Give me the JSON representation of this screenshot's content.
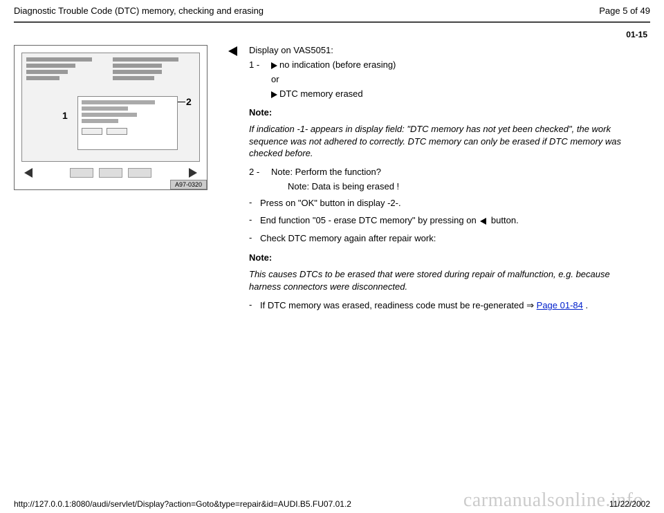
{
  "header": {
    "title": "Diagnostic Trouble Code (DTC) memory, checking and erasing",
    "page_label": "Page 5 of 49"
  },
  "section_number": "01-15",
  "figure": {
    "label_1": "1",
    "label_2": "2",
    "tag": "A97-0320"
  },
  "body": {
    "display_heading": "Display on VAS5051:",
    "item1_num": "1 - ",
    "item1_text": "no indication (before erasing)",
    "item1_or": "or",
    "item1_alt": "DTC memory erased",
    "note1_label": "Note:",
    "note1_text": "If indication -1- appears in display field: \"DTC memory has not yet been checked\", the work sequence was not adhered to correctly. DTC memory can only be erased if DTC memory was checked before.",
    "item2_num": "2 - ",
    "item2_text": "Note: Perform the function?",
    "item2_sub": "Note: Data is being erased !",
    "dash1": "Press on \"OK\" button in display -2-.",
    "dash2_a": "End function \"05 - erase DTC memory\" by pressing on ",
    "dash2_b": " button.",
    "dash3": "Check DTC memory again after repair work:",
    "note2_label": "Note:",
    "note2_text": "This causes DTCs to be erased that were stored during repair of malfunction, e.g. because harness connectors were disconnected.",
    "dash4_a": "If DTC memory was erased, readiness code must be re-generated  ",
    "dash4_link": "Page 01-84",
    "dash4_b": " ."
  },
  "footer": {
    "url": "http://127.0.0.1:8080/audi/servlet/Display?action=Goto&type=repair&id=AUDI.B5.FU07.01.2",
    "date": "11/22/2002"
  },
  "watermark": "carmanualsonline.info"
}
